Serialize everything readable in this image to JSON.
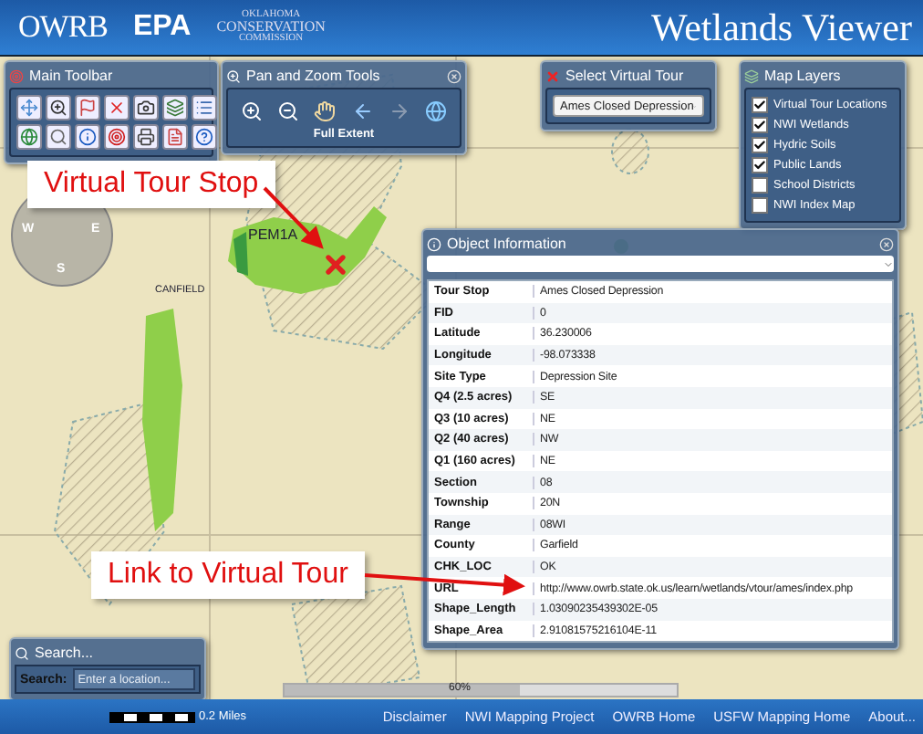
{
  "header": {
    "logos": [
      "OWRB",
      "EPA"
    ],
    "commission": [
      "OKLAHOMA",
      "CONSERVATION",
      "COMMISSION"
    ],
    "title": "Wetlands Viewer"
  },
  "main_toolbar": {
    "title": "Main Toolbar"
  },
  "pan_zoom": {
    "title": "Pan and Zoom Tools",
    "caption": "Full Extent"
  },
  "virtual_tour": {
    "title": "Select Virtual Tour",
    "value": "Ames Closed Depression"
  },
  "map_layers": {
    "title": "Map Layers",
    "items": [
      {
        "label": "Virtual Tour Locations",
        "checked": true
      },
      {
        "label": "NWI Wetlands",
        "checked": true
      },
      {
        "label": "Hydric Soils",
        "checked": true
      },
      {
        "label": "Public Lands",
        "checked": true
      },
      {
        "label": "School Districts",
        "checked": false
      },
      {
        "label": "NWI Index Map",
        "checked": false
      }
    ]
  },
  "map": {
    "labels": [
      "PEM1A",
      "CANFIELD"
    ],
    "compass": [
      "W",
      "E",
      "S"
    ],
    "progress": {
      "label": "60%",
      "level": 0.6
    },
    "scale": "0.2 Miles"
  },
  "callouts": [
    "Virtual Tour Stop",
    "Link to Virtual Tour"
  ],
  "object_info": {
    "title": "Object Information",
    "rows": [
      {
        "field": "Tour Stop",
        "value": "Ames Closed Depression"
      },
      {
        "field": "FID",
        "value": "0"
      },
      {
        "field": "Latitude",
        "value": "36.230006"
      },
      {
        "field": "Longitude",
        "value": "-98.073338"
      },
      {
        "field": "Site Type",
        "value": "Depression Site"
      },
      {
        "field": "Q4 (2.5 acres)",
        "value": "SE"
      },
      {
        "field": "Q3 (10 acres)",
        "value": "NE"
      },
      {
        "field": "Q2 (40 acres)",
        "value": "NW"
      },
      {
        "field": "Q1 (160 acres)",
        "value": "NE"
      },
      {
        "field": "Section",
        "value": "08"
      },
      {
        "field": "Township",
        "value": "20N"
      },
      {
        "field": "Range",
        "value": "08WI"
      },
      {
        "field": "County",
        "value": "Garfield"
      },
      {
        "field": "CHK_LOC",
        "value": "OK"
      },
      {
        "field": "URL",
        "value": "http://www.owrb.state.ok.us/learn/wetlands/vtour/ames/index.php"
      },
      {
        "field": "Shape_Length",
        "value": "1.03090235439302E-05"
      },
      {
        "field": "Shape_Area",
        "value": "2.91081575216104E-11"
      }
    ]
  },
  "search": {
    "title": "Search...",
    "label": "Search:",
    "placeholder": "Enter a location..."
  },
  "footer": {
    "links": [
      "Disclaimer",
      "NWI Mapping Project",
      "OWRB Home",
      "USFW Mapping Home",
      "About..."
    ]
  }
}
